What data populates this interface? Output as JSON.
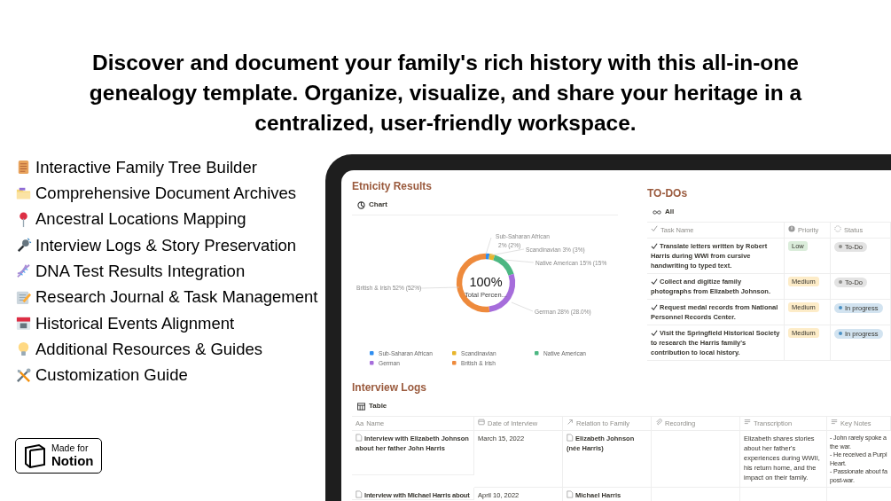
{
  "headline": "Discover and document your family's rich history with this all-in-one genealogy template. Organize, visualize, and share your heritage in a centralized, user-friendly workspace.",
  "features": [
    {
      "label": "Interactive Family Tree Builder"
    },
    {
      "label": "Comprehensive Document Archives"
    },
    {
      "label": "Ancestral Locations Mapping"
    },
    {
      "label": "Interview Logs & Story Preservation"
    },
    {
      "label": "DNA Test Results Integration"
    },
    {
      "label": "Research Journal & Task Management"
    },
    {
      "label": "Historical Events Alignment"
    },
    {
      "label": "Additional Resources & Guides"
    },
    {
      "label": "Customization Guide"
    }
  ],
  "badge": {
    "line1": "Made for",
    "line2": "Notion"
  },
  "ethnicity": {
    "title": "Etnicity Results",
    "view": "Chart",
    "center_value": "100%",
    "center_label": "Total Percen...",
    "chart_data": {
      "type": "donut",
      "categories": [
        "Sub-Saharan African",
        "Scandinavian",
        "Native American",
        "German",
        "British & Irish"
      ],
      "values": [
        2,
        3,
        15,
        28,
        52
      ],
      "legend": true
    },
    "slice_labels": [
      [
        "Sub-Saharan African",
        "2% (2%)"
      ],
      [
        "Scandinavian 3% (3%)"
      ],
      [
        "Native American 15% (15%"
      ],
      [
        "German 28% (28.0%)"
      ],
      [
        "British & Irish 52% (52%)"
      ]
    ],
    "legend": [
      {
        "color": "#2f8ef0"
      },
      {
        "color": "#e8b52c"
      },
      {
        "color": "#4cb782"
      },
      {
        "color": "#a66ddb"
      },
      {
        "color": "#ee8a3c"
      }
    ]
  },
  "todos": {
    "title": "TO-DOs",
    "view": "All",
    "columns": [
      "Task Name",
      "Priority",
      "Status"
    ],
    "rows": [
      {
        "task": "Translate letters written by Robert Harris during WWI from cursive handwriting to typed text.",
        "priority": {
          "label": "Low",
          "color": "#dbeddb"
        },
        "status": {
          "label": "To-Do",
          "color": "#91918e"
        }
      },
      {
        "task": "Collect and digitize family photographs from Elizabeth Johnson.",
        "priority": {
          "label": "Medium",
          "color": "#fdecc8"
        },
        "status": {
          "label": "To-Do",
          "color": "#91918e"
        }
      },
      {
        "task": "Request medal records from National Personnel Records Center.",
        "priority": {
          "label": "Medium",
          "color": "#fdecc8"
        },
        "status": {
          "label": "In progress",
          "color": "#4a90c4"
        }
      },
      {
        "task": "Visit the Springfield Historical Society to research the Harris family's contribution to local history.",
        "priority": {
          "label": "Medium",
          "color": "#fdecc8"
        },
        "status": {
          "label": "In progress",
          "color": "#4a90c4"
        }
      }
    ]
  },
  "interviews": {
    "title": "Interview Logs",
    "view": "Table",
    "columns": [
      {
        "label": "Name",
        "icon_text": "Aa"
      },
      {
        "label": "Date of Interview"
      },
      {
        "label": "Relation to Family"
      },
      {
        "label": "Recording"
      },
      {
        "label": "Transcription"
      },
      {
        "label": "Key Notes"
      }
    ],
    "rows": [
      {
        "name": "Interview with Elizabeth Johnson about her father John Harris",
        "date": "March 15, 2022",
        "relation": "Elizabeth Johnson (née Harris)",
        "transcription": "Elizabeth shares stories about her father's experiences during WWII, his return home, and the impact on their family.",
        "key_notes": [
          "- John rarely spoke a",
          "the war.",
          "- He received a Purpl",
          "Heart.",
          "- Passionate about fa",
          "post-war."
        ]
      },
      {
        "name": "Interview with Michael Harris about",
        "date": "April 10, 2022",
        "relation": "Michael Harris"
      }
    ]
  }
}
